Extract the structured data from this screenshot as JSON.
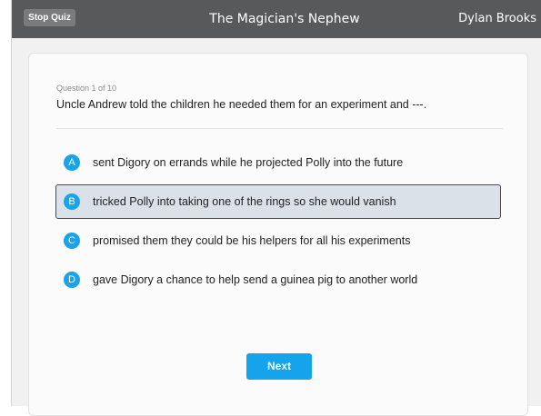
{
  "header": {
    "stop_label": "Stop Quiz",
    "title": "The Magician's Nephew",
    "user": "Dylan Brooks"
  },
  "question": {
    "counter": "Question 1 of 10",
    "text": "Uncle Andrew told the children he needed them for an experiment and ---.",
    "selected": "B"
  },
  "options": [
    {
      "letter": "A",
      "text": "sent Digory on errands while he projected Polly into the future"
    },
    {
      "letter": "B",
      "text": "tricked Polly into taking one of the rings so she would vanish"
    },
    {
      "letter": "C",
      "text": "promised them they could be his helpers for all his experiments"
    },
    {
      "letter": "D",
      "text": "gave Digory a chance to help send a guinea pig to another world"
    }
  ],
  "footer": {
    "next_label": "Next"
  },
  "colors": {
    "topbar": "#58595b",
    "accent": "#1aa3e8",
    "selected_bg": "#dbe1e9"
  }
}
